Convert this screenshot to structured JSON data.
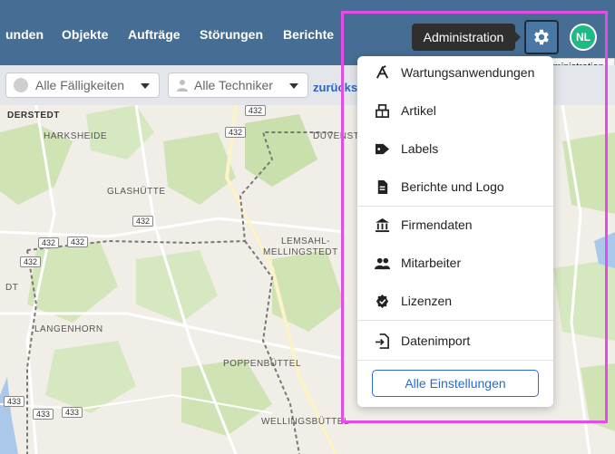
{
  "nav": {
    "items": [
      "unden",
      "Objekte",
      "Aufträge",
      "Störungen",
      "Berichte"
    ],
    "tooltip": "Administration",
    "avatar": "NL",
    "native_tooltip": "Administration"
  },
  "filters": {
    "due": "Alle Fälligkeiten",
    "tech": "Alle Techniker",
    "reset": "zurücks"
  },
  "map": {
    "places": [
      "DERSTEDT",
      "HARKSHEIDE",
      "DUVENST",
      "GLASHÜTTE",
      "LEMSAHL-",
      "MELLINGSTEDT",
      "DT",
      "LANGENHORN",
      "POPPENBÜTTEL",
      "WELLINGSBÜTTEL"
    ],
    "road_number": "432",
    "road_number_2": "433"
  },
  "menu": {
    "items": [
      {
        "label": "Wartungsanwendungen",
        "icon": "maintenance-icon"
      },
      {
        "label": "Artikel",
        "icon": "article-icon"
      },
      {
        "label": "Labels",
        "icon": "tag-icon"
      },
      {
        "label": "Berichte und Logo",
        "icon": "document-icon"
      },
      {
        "label": "Firmendaten",
        "icon": "building-icon"
      },
      {
        "label": "Mitarbeiter",
        "icon": "users-icon"
      },
      {
        "label": "Lizenzen",
        "icon": "badge-icon"
      },
      {
        "label": "Datenimport",
        "icon": "import-icon"
      }
    ],
    "all_settings": "Alle Einstellungen"
  },
  "colors": {
    "nav": "#466e94",
    "accent": "#2a6ad0",
    "avatar": "#1fb985",
    "highlight": "#e44ce8"
  }
}
